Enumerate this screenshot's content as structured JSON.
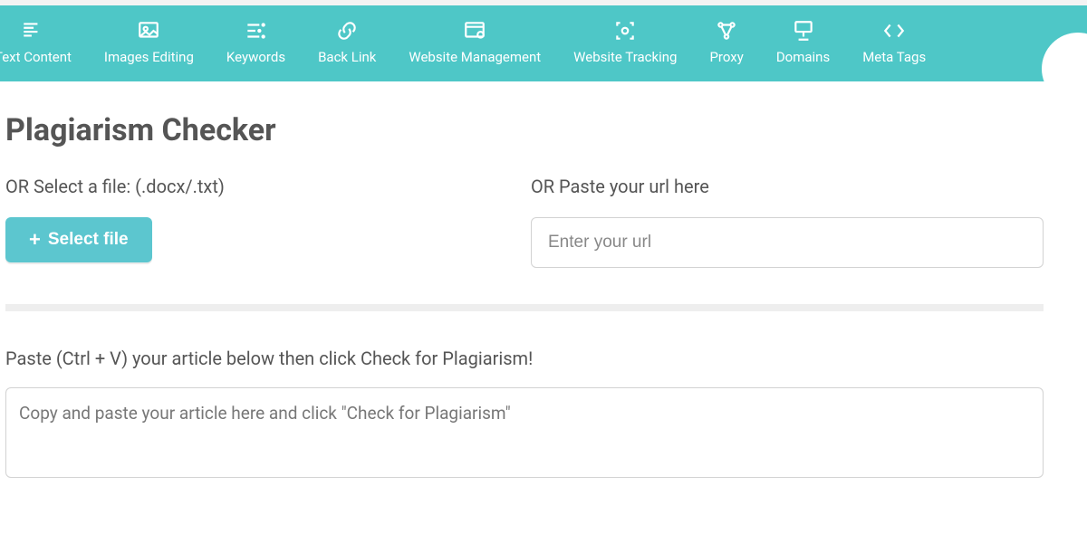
{
  "nav": {
    "items": [
      {
        "label": "Text Content",
        "icon": "text-content-icon"
      },
      {
        "label": "Images Editing",
        "icon": "images-editing-icon"
      },
      {
        "label": "Keywords",
        "icon": "keywords-icon"
      },
      {
        "label": "Back Link",
        "icon": "back-link-icon"
      },
      {
        "label": "Website Management",
        "icon": "website-management-icon"
      },
      {
        "label": "Website Tracking",
        "icon": "website-tracking-icon"
      },
      {
        "label": "Proxy",
        "icon": "proxy-icon"
      },
      {
        "label": "Domains",
        "icon": "domains-icon"
      },
      {
        "label": "Meta Tags",
        "icon": "meta-tags-icon"
      }
    ]
  },
  "page": {
    "title": "Plagiarism Checker"
  },
  "file_section": {
    "label": "OR Select a file: (.docx/.txt)",
    "button_label": "Select file"
  },
  "url_section": {
    "label": "OR Paste your url here",
    "placeholder": "Enter your url",
    "value": ""
  },
  "article_section": {
    "label": "Paste (Ctrl + V) your article below then click Check for Plagiarism!",
    "placeholder": "Copy and paste your article here and click \"Check for Plagiarism\"",
    "value": ""
  },
  "colors": {
    "accent": "#4ec7c7",
    "button": "#5cc6cf"
  }
}
